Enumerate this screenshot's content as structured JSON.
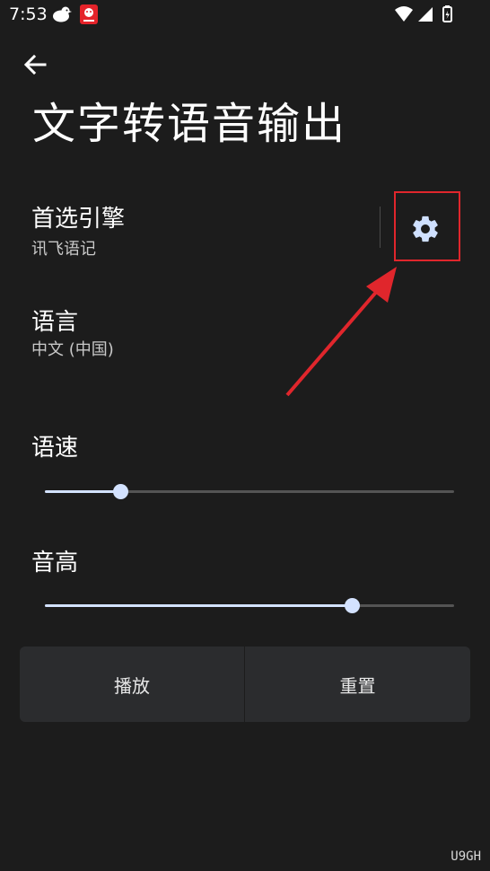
{
  "status_bar": {
    "time": "7:53",
    "icons": [
      "bird-icon",
      "app-badge-icon",
      "wifi-icon",
      "signal-icon",
      "battery-icon"
    ]
  },
  "toolbar": {
    "back_icon": "arrow-left-icon"
  },
  "page": {
    "title": "文字转语音输出"
  },
  "preferred_engine": {
    "title": "首选引擎",
    "value": "讯飞语记",
    "settings_icon": "gear-icon"
  },
  "language": {
    "title": "语言",
    "value": "中文 (中国)"
  },
  "speech_rate": {
    "label": "语速",
    "level": 0.185
  },
  "pitch": {
    "label": "音高",
    "level": 0.75
  },
  "buttons": {
    "play": "播放",
    "reset": "重置"
  },
  "annotation": {
    "highlight_color": "#e0262c"
  },
  "colors": {
    "background": "#1c1c1c",
    "accent": "#d3e2ff",
    "button_bg": "#2b2c2e"
  },
  "watermark": "U9GH"
}
